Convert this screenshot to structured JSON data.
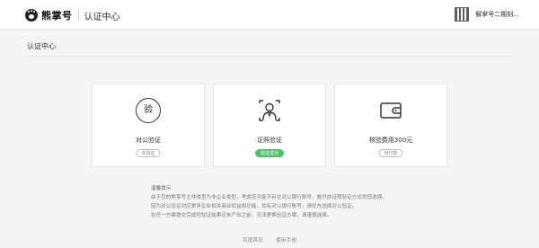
{
  "header": {
    "brand": "熊掌号",
    "section": "认证中心",
    "account_name": "解掌号二期刻..."
  },
  "page_title": "认证中心",
  "cards": [
    {
      "icon": "verify-stamp-icon",
      "icon_text": "验",
      "label": "对公验证",
      "tag": "未验证",
      "tag_style": "gray"
    },
    {
      "icon": "id-photo-icon",
      "label": "证照验证",
      "tag": "验证成功",
      "tag_style": "green"
    },
    {
      "icon": "wallet-icon",
      "label": "核验费用300元",
      "tag": "待付款",
      "tag_style": "gray"
    }
  ],
  "notes": {
    "title": "温馨提示",
    "lines": [
      "由于您的熊掌号主体类型为非企业类型，考虑您可能不存在对公银行账号，故开放证照验证方式供您选择。",
      "因为对公验证对应更多企业相关商业权益和功能，如有对公银行账号，请优先选择对公验证。",
      "在任一方案提交完成但验证结果还未产出之前，无法更换验证方案，请谨慎选择。"
    ]
  },
  "footer_links": [
    "百度首页",
    "使用手册"
  ],
  "colors": {
    "success_green": "#4fc26b"
  }
}
